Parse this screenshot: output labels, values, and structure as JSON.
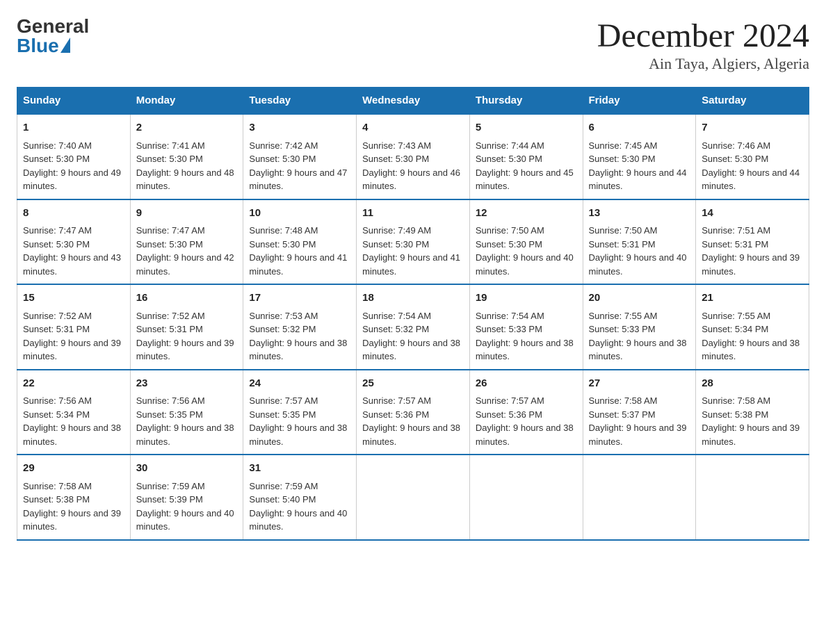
{
  "header": {
    "logo_general": "General",
    "logo_blue": "Blue",
    "main_title": "December 2024",
    "subtitle": "Ain Taya, Algiers, Algeria"
  },
  "columns": [
    "Sunday",
    "Monday",
    "Tuesday",
    "Wednesday",
    "Thursday",
    "Friday",
    "Saturday"
  ],
  "weeks": [
    [
      {
        "day": "1",
        "sunrise": "7:40 AM",
        "sunset": "5:30 PM",
        "daylight": "9 hours and 49 minutes."
      },
      {
        "day": "2",
        "sunrise": "7:41 AM",
        "sunset": "5:30 PM",
        "daylight": "9 hours and 48 minutes."
      },
      {
        "day": "3",
        "sunrise": "7:42 AM",
        "sunset": "5:30 PM",
        "daylight": "9 hours and 47 minutes."
      },
      {
        "day": "4",
        "sunrise": "7:43 AM",
        "sunset": "5:30 PM",
        "daylight": "9 hours and 46 minutes."
      },
      {
        "day": "5",
        "sunrise": "7:44 AM",
        "sunset": "5:30 PM",
        "daylight": "9 hours and 45 minutes."
      },
      {
        "day": "6",
        "sunrise": "7:45 AM",
        "sunset": "5:30 PM",
        "daylight": "9 hours and 44 minutes."
      },
      {
        "day": "7",
        "sunrise": "7:46 AM",
        "sunset": "5:30 PM",
        "daylight": "9 hours and 44 minutes."
      }
    ],
    [
      {
        "day": "8",
        "sunrise": "7:47 AM",
        "sunset": "5:30 PM",
        "daylight": "9 hours and 43 minutes."
      },
      {
        "day": "9",
        "sunrise": "7:47 AM",
        "sunset": "5:30 PM",
        "daylight": "9 hours and 42 minutes."
      },
      {
        "day": "10",
        "sunrise": "7:48 AM",
        "sunset": "5:30 PM",
        "daylight": "9 hours and 41 minutes."
      },
      {
        "day": "11",
        "sunrise": "7:49 AM",
        "sunset": "5:30 PM",
        "daylight": "9 hours and 41 minutes."
      },
      {
        "day": "12",
        "sunrise": "7:50 AM",
        "sunset": "5:30 PM",
        "daylight": "9 hours and 40 minutes."
      },
      {
        "day": "13",
        "sunrise": "7:50 AM",
        "sunset": "5:31 PM",
        "daylight": "9 hours and 40 minutes."
      },
      {
        "day": "14",
        "sunrise": "7:51 AM",
        "sunset": "5:31 PM",
        "daylight": "9 hours and 39 minutes."
      }
    ],
    [
      {
        "day": "15",
        "sunrise": "7:52 AM",
        "sunset": "5:31 PM",
        "daylight": "9 hours and 39 minutes."
      },
      {
        "day": "16",
        "sunrise": "7:52 AM",
        "sunset": "5:31 PM",
        "daylight": "9 hours and 39 minutes."
      },
      {
        "day": "17",
        "sunrise": "7:53 AM",
        "sunset": "5:32 PM",
        "daylight": "9 hours and 38 minutes."
      },
      {
        "day": "18",
        "sunrise": "7:54 AM",
        "sunset": "5:32 PM",
        "daylight": "9 hours and 38 minutes."
      },
      {
        "day": "19",
        "sunrise": "7:54 AM",
        "sunset": "5:33 PM",
        "daylight": "9 hours and 38 minutes."
      },
      {
        "day": "20",
        "sunrise": "7:55 AM",
        "sunset": "5:33 PM",
        "daylight": "9 hours and 38 minutes."
      },
      {
        "day": "21",
        "sunrise": "7:55 AM",
        "sunset": "5:34 PM",
        "daylight": "9 hours and 38 minutes."
      }
    ],
    [
      {
        "day": "22",
        "sunrise": "7:56 AM",
        "sunset": "5:34 PM",
        "daylight": "9 hours and 38 minutes."
      },
      {
        "day": "23",
        "sunrise": "7:56 AM",
        "sunset": "5:35 PM",
        "daylight": "9 hours and 38 minutes."
      },
      {
        "day": "24",
        "sunrise": "7:57 AM",
        "sunset": "5:35 PM",
        "daylight": "9 hours and 38 minutes."
      },
      {
        "day": "25",
        "sunrise": "7:57 AM",
        "sunset": "5:36 PM",
        "daylight": "9 hours and 38 minutes."
      },
      {
        "day": "26",
        "sunrise": "7:57 AM",
        "sunset": "5:36 PM",
        "daylight": "9 hours and 38 minutes."
      },
      {
        "day": "27",
        "sunrise": "7:58 AM",
        "sunset": "5:37 PM",
        "daylight": "9 hours and 39 minutes."
      },
      {
        "day": "28",
        "sunrise": "7:58 AM",
        "sunset": "5:38 PM",
        "daylight": "9 hours and 39 minutes."
      }
    ],
    [
      {
        "day": "29",
        "sunrise": "7:58 AM",
        "sunset": "5:38 PM",
        "daylight": "9 hours and 39 minutes."
      },
      {
        "day": "30",
        "sunrise": "7:59 AM",
        "sunset": "5:39 PM",
        "daylight": "9 hours and 40 minutes."
      },
      {
        "day": "31",
        "sunrise": "7:59 AM",
        "sunset": "5:40 PM",
        "daylight": "9 hours and 40 minutes."
      },
      null,
      null,
      null,
      null
    ]
  ]
}
